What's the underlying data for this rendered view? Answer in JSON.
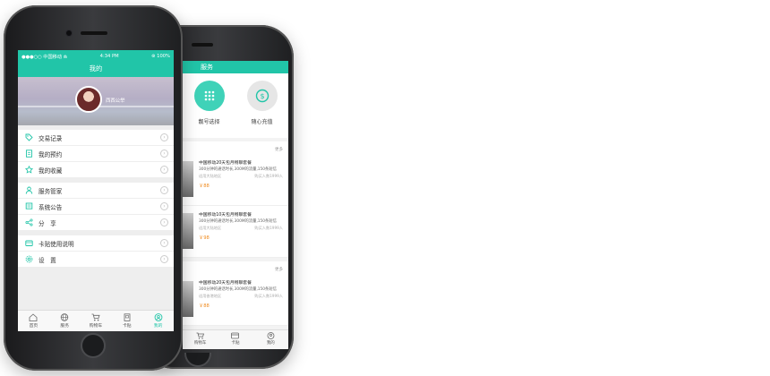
{
  "colors": {
    "accent": "#21c5a8",
    "price": "#f08a1d"
  },
  "front": {
    "status": {
      "carrier": "●●●○○ 中国移动 ⋒",
      "time": "4:34 PM",
      "battery": "⊛ 100%"
    },
    "title": "我的",
    "profile": {
      "name": "西西公举"
    },
    "groups": [
      [
        {
          "label": "交易记录",
          "icon": "tag-icon"
        },
        {
          "label": "我的预约",
          "icon": "document-icon"
        },
        {
          "label": "我的收藏",
          "icon": "star-icon"
        }
      ],
      [
        {
          "label": "服务管家",
          "icon": "butler-icon"
        },
        {
          "label": "系统公告",
          "icon": "announcement-icon"
        },
        {
          "label": "分　享",
          "icon": "share-icon"
        }
      ],
      [
        {
          "label": "卡贴使用说明",
          "icon": "wallet-icon"
        },
        {
          "label": "设　置",
          "icon": "gear-icon"
        }
      ]
    ],
    "tabs": [
      {
        "label": "首页",
        "icon": "home-icon"
      },
      {
        "label": "服务",
        "icon": "globe-icon"
      },
      {
        "label": "购物车",
        "icon": "cart-icon"
      },
      {
        "label": "卡贴",
        "icon": "card-icon"
      },
      {
        "label": "我的",
        "icon": "user-icon",
        "active": true
      }
    ]
  },
  "back": {
    "title": "服务",
    "services": [
      {
        "label": "靓号选择",
        "icon": "dialpad-icon"
      },
      {
        "label": "随心充值",
        "icon": "dollar-icon"
      }
    ],
    "more": "更多",
    "sections": [
      [
        {
          "title": "中国移动20天包月畅聊套餐",
          "desc": "300分钟的通话时长,300M的流量,150条短信",
          "region": "适用大陆地区",
          "buyers": "购买人数1999人",
          "price": "￥88"
        },
        {
          "title": "中国移动10天包月畅聊套餐",
          "desc": "300分钟的通话时长,300M的流量,150条短信",
          "region": "适用大陆地区",
          "buyers": "购买人数1999人",
          "price": "￥98"
        }
      ],
      [
        {
          "title": "中国移动20天包月畅聊套餐",
          "desc": "300分钟的通话时长,300M的流量,150条短信",
          "region": "适用香港地区",
          "buyers": "购买人数1999人",
          "price": "￥88"
        }
      ]
    ],
    "tabs": [
      {
        "label": "购物车",
        "icon": "cart-icon"
      },
      {
        "label": "卡贴",
        "icon": "card-icon"
      },
      {
        "label": "我的",
        "icon": "user-icon"
      }
    ]
  }
}
